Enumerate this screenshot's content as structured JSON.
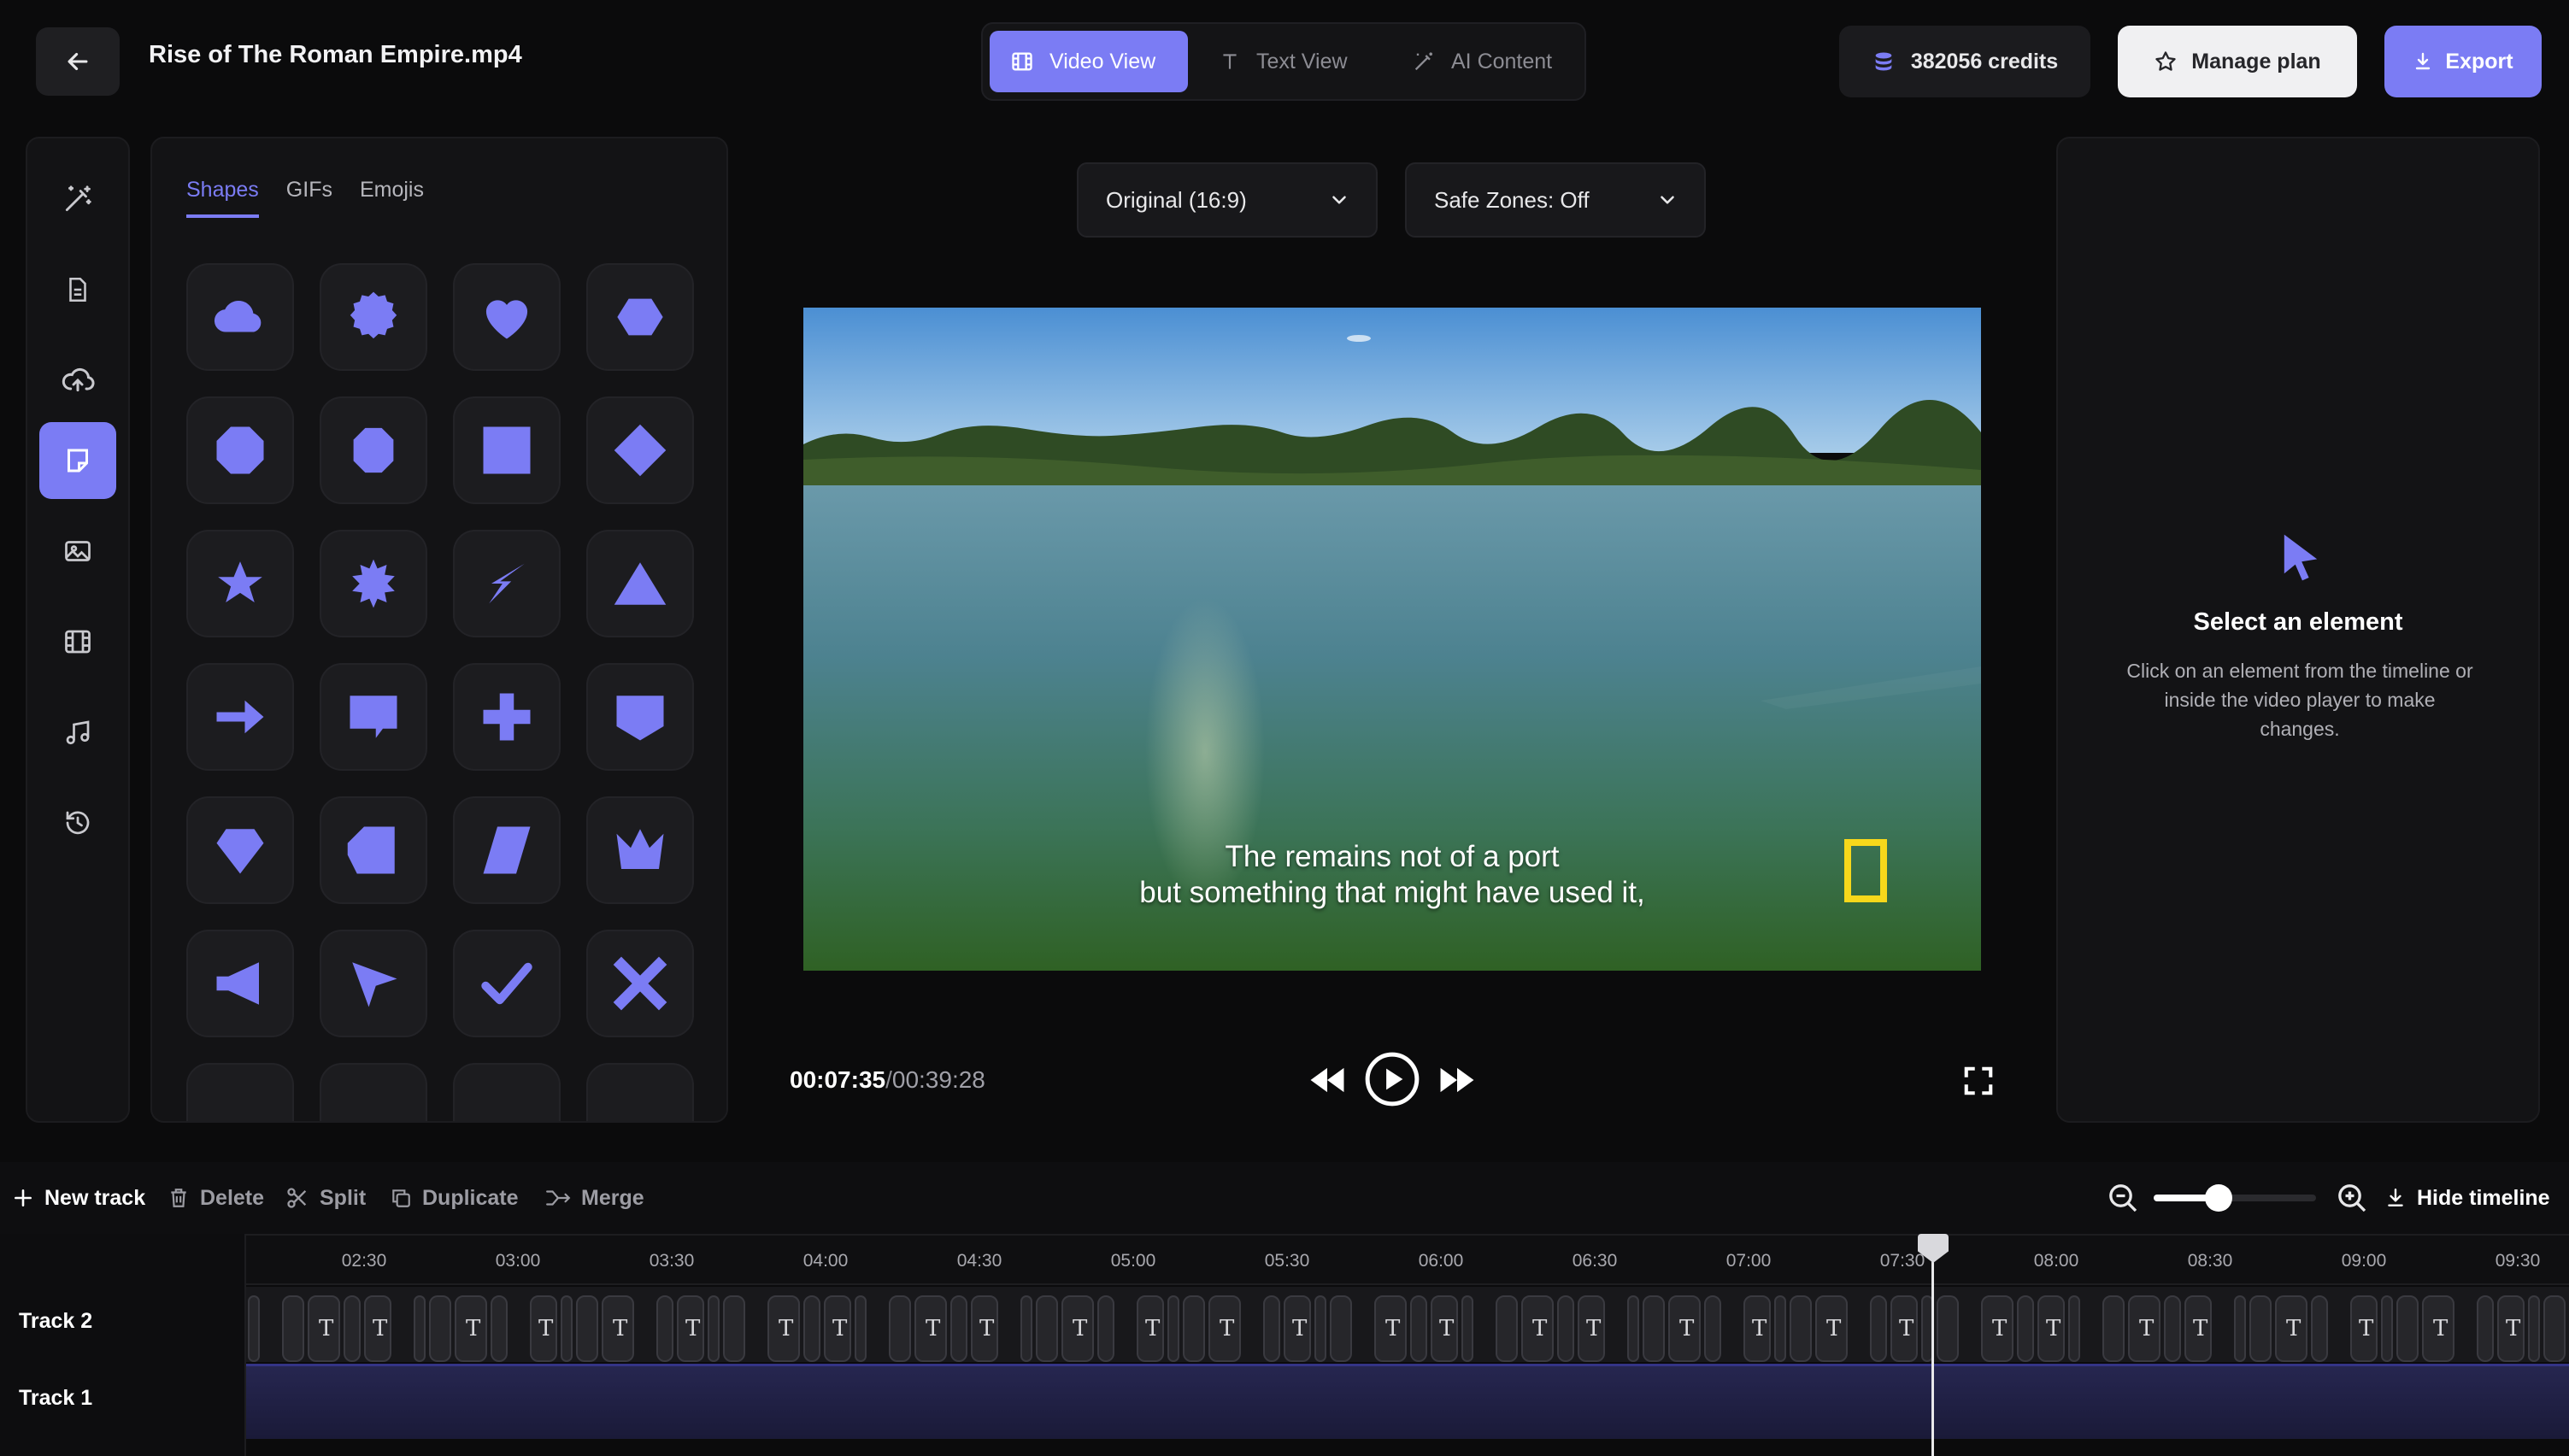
{
  "header": {
    "file_title": "Rise of The Roman Empire.mp4",
    "view_tabs": [
      {
        "label": "Video View",
        "icon": "film-icon"
      },
      {
        "label": "Text View",
        "icon": "text-icon"
      },
      {
        "label": "AI Content",
        "icon": "magic-wand-icon"
      }
    ],
    "credits": "382056 credits",
    "manage_plan": "Manage plan",
    "export": "Export"
  },
  "rail": {
    "items": [
      "magic-wand-icon",
      "document-icon",
      "upload-cloud-icon",
      "sticker-icon",
      "image-icon",
      "film-icon",
      "music-icon",
      "history-icon"
    ],
    "active_index": 3
  },
  "shapes_panel": {
    "tabs": [
      "Shapes",
      "GIFs",
      "Emojis"
    ],
    "active_tab": "Shapes",
    "shapes": [
      "cloud",
      "badge",
      "heart",
      "hexagon",
      "octagon",
      "heptagon",
      "square",
      "diamond",
      "star",
      "starburst",
      "lightning",
      "triangle",
      "arrow-right",
      "speech-bubble",
      "cross",
      "shield",
      "gem",
      "pentagon",
      "parallelogram",
      "crown",
      "megaphone",
      "cursor",
      "checkmark",
      "x-mark"
    ]
  },
  "player": {
    "aspect_label": "Original (16:9)",
    "safe_zones_label": "Safe Zones: Off",
    "caption_line1": "The remains not of a port",
    "caption_line2": "but something that might have used it,",
    "current_time": "00:07:35",
    "separator": "/",
    "duration": "00:39:28"
  },
  "inspector": {
    "title": "Select an element",
    "description": "Click on an element from the timeline or inside the video player to make changes."
  },
  "timeline_toolbar": {
    "new_track": "New track",
    "delete": "Delete",
    "split": "Split",
    "duplicate": "Duplicate",
    "merge": "Merge",
    "hide_timeline": "Hide timeline",
    "zoom_level": 0.4
  },
  "timeline": {
    "ticks": [
      "02:30",
      "03:00",
      "03:30",
      "04:00",
      "04:30",
      "05:00",
      "05:30",
      "06:00",
      "06:30",
      "07:00",
      "07:30",
      "08:00",
      "08:30",
      "09:00",
      "09:30"
    ],
    "tracks": [
      "Track 2",
      "Track 1"
    ],
    "playhead_time": "07:35"
  },
  "colors": {
    "accent": "#7b7cf4",
    "background": "#0b0b0c",
    "panel": "#131315"
  }
}
